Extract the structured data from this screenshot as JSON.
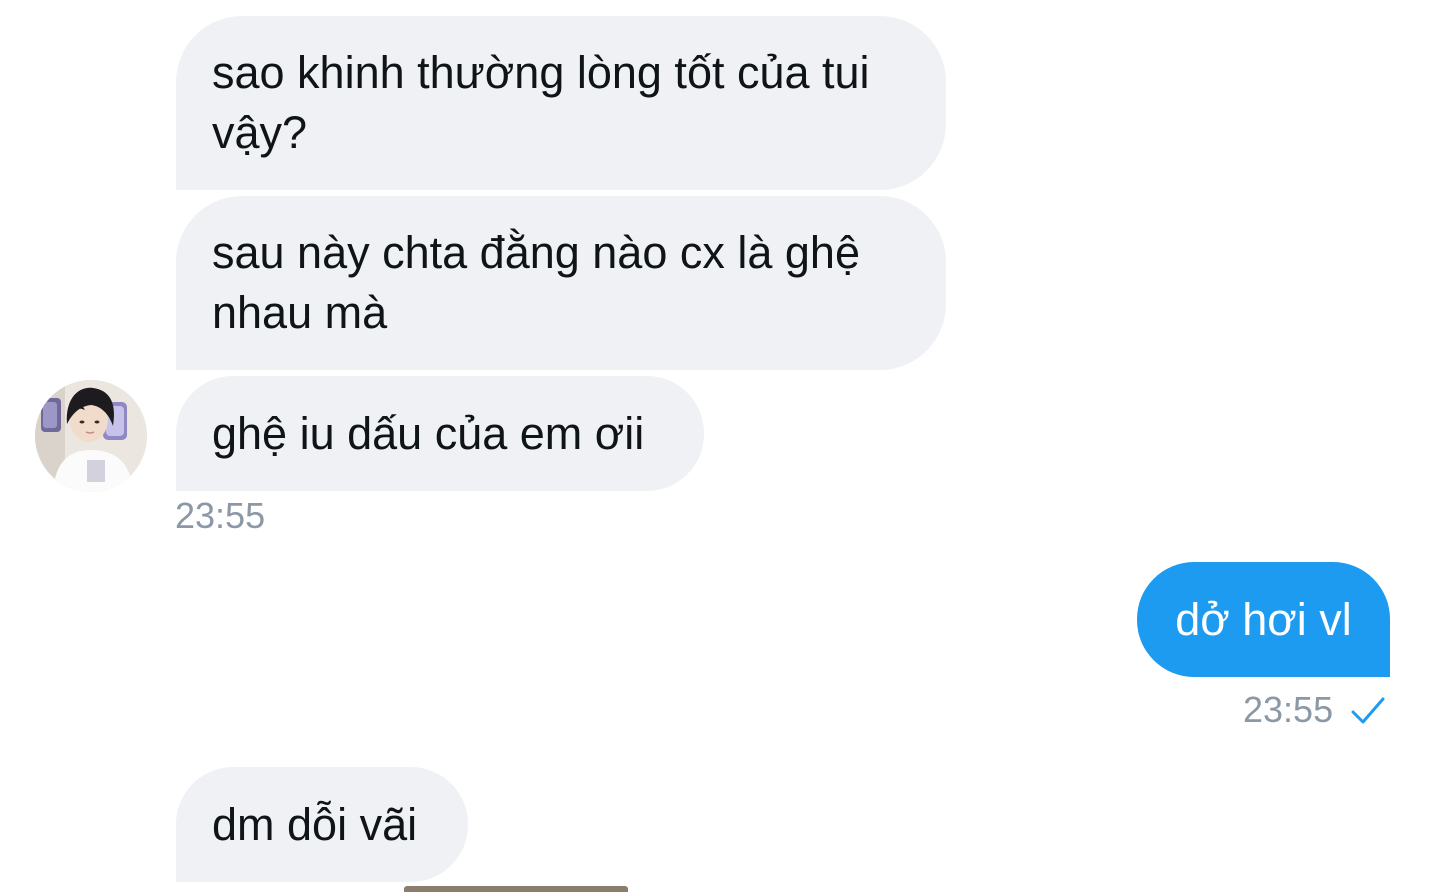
{
  "messages": {
    "received": [
      {
        "text": "sao khinh thường lòng tốt của tui vậy?"
      },
      {
        "text": "sau này chta đằng nào cx là ghệ nhau mà"
      },
      {
        "text": "ghệ iu dấu của em ơii"
      },
      {
        "text": "dm dỗi vãi"
      }
    ],
    "received_time": "23:55",
    "sent": [
      {
        "text": "dở hơi vl"
      }
    ],
    "sent_time": "23:55"
  },
  "colors": {
    "incoming_bubble": "#eff1f4",
    "outgoing_bubble": "#1d9bf0",
    "timestamp": "#8b98a5",
    "read_check": "#1d9bf0"
  },
  "icons": {
    "read_status": "check-icon",
    "sender_avatar": "avatar"
  }
}
